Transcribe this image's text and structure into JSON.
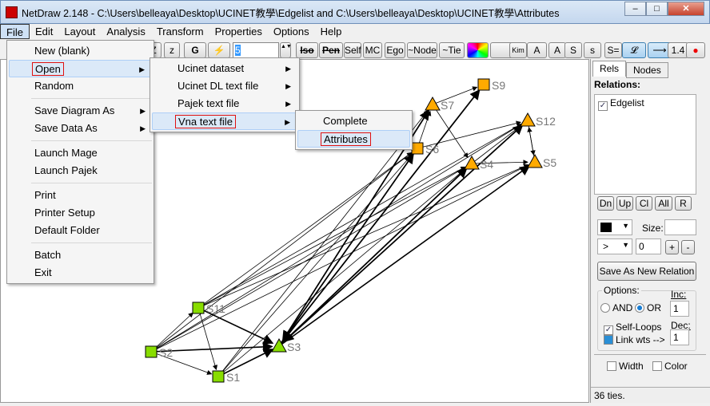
{
  "window": {
    "title": "NetDraw 2.148 - C:\\Users\\belleaya\\Desktop\\UCINET教學\\Edgelist and C:\\Users\\belleaya\\Desktop\\UCINET教學\\Attributes",
    "min": "–",
    "max": "□",
    "close": "✕"
  },
  "menubar": [
    "File",
    "Edit",
    "Layout",
    "Analysis",
    "Transform",
    "Properties",
    "Options",
    "Help"
  ],
  "toolbar": {
    "buttons": [
      "Z",
      "z",
      "G",
      "⚡"
    ],
    "spin_value": "5",
    "buttons2": [
      "Iso",
      "Pen",
      "Self",
      "MC",
      "Ego",
      "~Node",
      "~Tie",
      "",
      "",
      "Kim Bill",
      "A",
      "A",
      "S",
      "s",
      "S=",
      "𝓛",
      "⟶",
      "1.4",
      "●"
    ]
  },
  "file_menu": {
    "items": [
      {
        "label": "New (blank)"
      },
      {
        "label": "Open",
        "submenu": true
      },
      {
        "label": "Random"
      },
      {
        "sep": true
      },
      {
        "label": "Save Diagram As",
        "submenu": true
      },
      {
        "label": "Save Data As",
        "submenu": true
      },
      {
        "sep": true
      },
      {
        "label": "Launch Mage"
      },
      {
        "label": "Launch Pajek"
      },
      {
        "sep": true
      },
      {
        "label": "Print"
      },
      {
        "label": "Printer Setup"
      },
      {
        "label": "Default Folder"
      },
      {
        "sep": true
      },
      {
        "label": "Batch"
      },
      {
        "label": "Exit"
      }
    ]
  },
  "open_menu": {
    "items": [
      "Ucinet dataset",
      "Ucinet DL text file",
      "Pajek text file",
      "Vna text file"
    ]
  },
  "vna_menu": {
    "items": [
      "Complete",
      "Attributes"
    ]
  },
  "network": {
    "nodes": [
      {
        "id": "S9",
        "shape": "square",
        "color": "#ffaa00"
      },
      {
        "id": "S7",
        "shape": "triangle",
        "color": "#ffaa00"
      },
      {
        "id": "S12",
        "shape": "triangle",
        "color": "#ffaa00"
      },
      {
        "id": "S6",
        "shape": "square",
        "color": "#ffaa00"
      },
      {
        "id": "S4",
        "shape": "triangle",
        "color": "#ffaa00"
      },
      {
        "id": "S5",
        "shape": "triangle",
        "color": "#ffaa00"
      },
      {
        "id": "S11",
        "shape": "square",
        "color": "#88dd00"
      },
      {
        "id": "S2",
        "shape": "square",
        "color": "#88dd00"
      },
      {
        "id": "S3",
        "shape": "triangle",
        "color": "#88dd00"
      },
      {
        "id": "S1",
        "shape": "square",
        "color": "#88dd00"
      }
    ],
    "edges": [
      [
        "S3",
        "S7"
      ],
      [
        "S3",
        "S6"
      ],
      [
        "S3",
        "S4"
      ],
      [
        "S3",
        "S12"
      ],
      [
        "S3",
        "S9"
      ],
      [
        "S3",
        "S5"
      ],
      [
        "S1",
        "S3"
      ],
      [
        "S1",
        "S4"
      ],
      [
        "S1",
        "S6"
      ],
      [
        "S1",
        "S7"
      ],
      [
        "S2",
        "S3"
      ],
      [
        "S2",
        "S1"
      ],
      [
        "S2",
        "S11"
      ],
      [
        "S2",
        "S12"
      ],
      [
        "S2",
        "S4"
      ],
      [
        "S2",
        "S6"
      ],
      [
        "S2",
        "S5"
      ],
      [
        "S11",
        "S1"
      ],
      [
        "S11",
        "S6"
      ],
      [
        "S11",
        "S12"
      ],
      [
        "S11",
        "S4"
      ],
      [
        "S11",
        "S5"
      ],
      [
        "S11",
        "S3"
      ],
      [
        "S7",
        "S9"
      ],
      [
        "S7",
        "S4"
      ],
      [
        "S6",
        "S7"
      ],
      [
        "S6",
        "S12"
      ],
      [
        "S4",
        "S12"
      ],
      [
        "S12",
        "S5"
      ],
      [
        "S5",
        "S12"
      ],
      [
        "S4",
        "S5"
      ],
      [
        "S9",
        "S3"
      ],
      [
        "S7",
        "S3"
      ],
      [
        "S12",
        "S3"
      ],
      [
        "S4",
        "S3"
      ],
      [
        "S6",
        "S3"
      ]
    ]
  },
  "panel": {
    "tabs": [
      "Rels",
      "Nodes"
    ],
    "relations_label": "Relations:",
    "relations": [
      {
        "label": "Edgelist",
        "checked": true
      }
    ],
    "order_buttons": [
      "Dn",
      "Up",
      "Cl",
      "All",
      "R"
    ],
    "size_label": "Size:",
    "size_value": "",
    "op_value": ">",
    "threshold": "0",
    "plus": "+",
    "minus": "-",
    "save_button": "Save As New Relation",
    "options_label": "Options:",
    "and_label": "AND",
    "or_label": "OR",
    "or_selected": true,
    "inc_label": "Inc:",
    "inc_value": "1",
    "dec_label": "Dec:",
    "dec_value": "1",
    "self_loops": "Self-Loops",
    "link_wts": "Link wts -->",
    "width_label": "Width",
    "color_label": "Color",
    "status": "36 ties."
  }
}
